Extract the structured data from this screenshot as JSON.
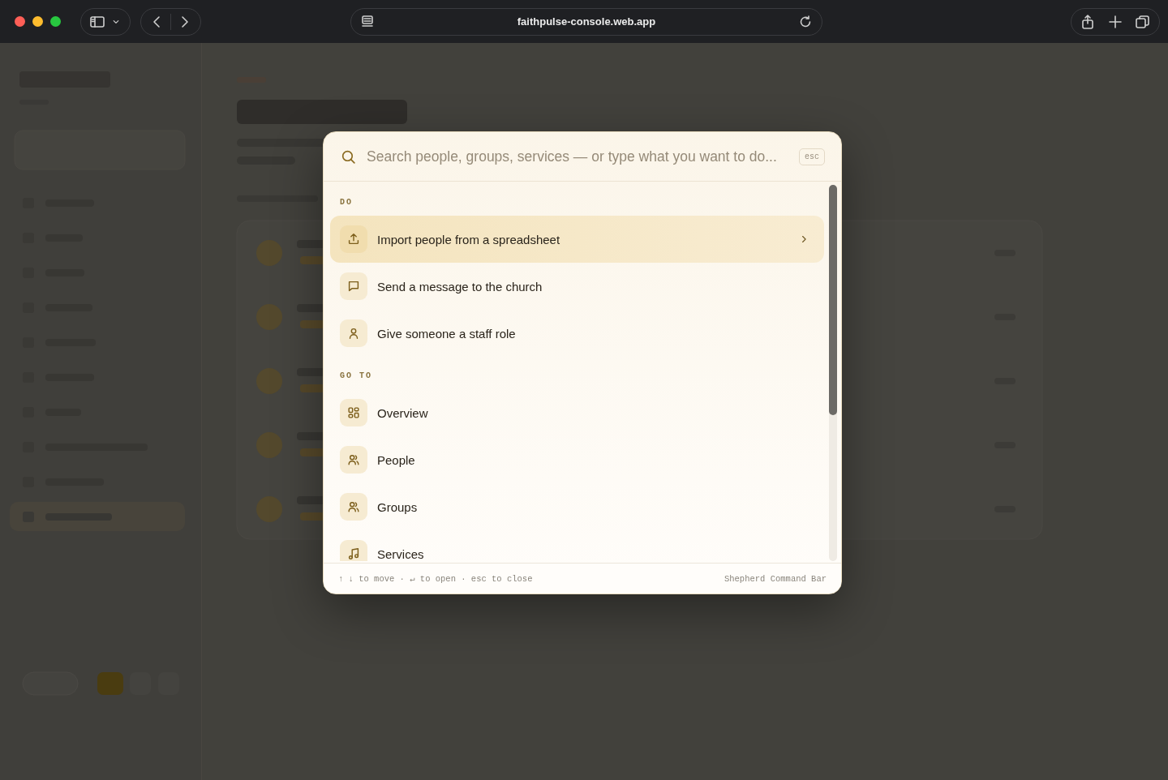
{
  "browser": {
    "url": "faithpulse-console.web.app"
  },
  "command_bar": {
    "placeholder": "Search people, groups, services — or type what you want to do...",
    "esc_key": "esc",
    "sections": [
      {
        "label": "DO",
        "items": [
          {
            "label": "Import people from a spreadsheet",
            "kind": "upload",
            "selected": true
          },
          {
            "label": "Send a message to the church",
            "kind": "message",
            "selected": false
          },
          {
            "label": "Give someone a staff role",
            "kind": "person",
            "selected": false
          }
        ]
      },
      {
        "label": "GO TO",
        "items": [
          {
            "label": "Overview",
            "kind": "grid",
            "selected": false
          },
          {
            "label": "People",
            "kind": "people",
            "selected": false
          },
          {
            "label": "Groups",
            "kind": "people",
            "selected": false
          },
          {
            "label": "Services",
            "kind": "music",
            "selected": false
          }
        ]
      }
    ],
    "hint": "↑ ↓ to move · ↵ to open · esc to close",
    "brand": "Shepherd Command Bar"
  }
}
